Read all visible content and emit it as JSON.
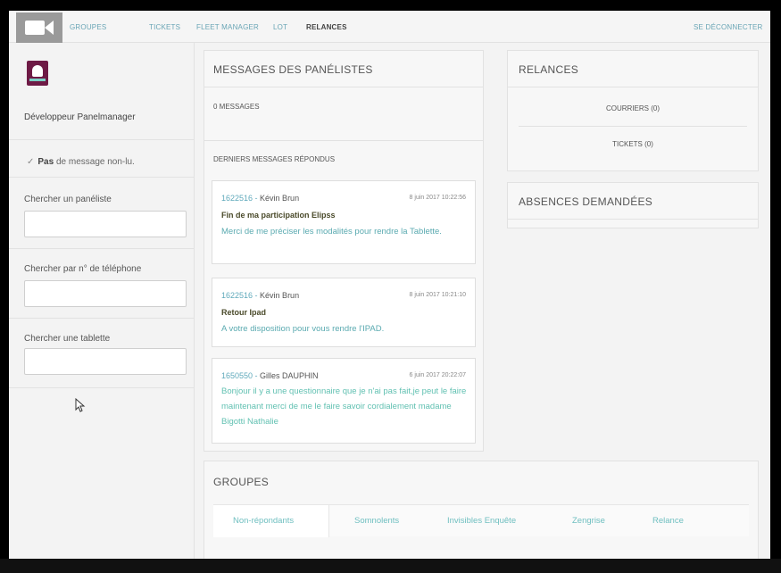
{
  "nav": {
    "items": [
      "GROUPES",
      "TICKETS",
      "FLEET MANAGER",
      "LOT",
      "RELANCES"
    ],
    "logout": "SE DÉCONNECTER"
  },
  "sidebar": {
    "user_name": "Développeur Panelmanager",
    "unread_bold": "Pas",
    "unread_rest": "de message non-lu.",
    "search_panelist_label": "Chercher un panéliste",
    "search_phone_label": "Chercher par n° de téléphone",
    "search_tablet_label": "Chercher une tablette",
    "search_panelist_value": "",
    "search_phone_value": "",
    "search_tablet_value": ""
  },
  "messages": {
    "title": "MESSAGES DES PANÉLISTES",
    "count": "0 MESSAGES",
    "replied_title": "DERNIERS MESSAGES RÉPONDUS",
    "items": [
      {
        "id": "1622516",
        "author": "Kévin Brun",
        "date": "8 juin 2017 10:22:56",
        "subject": "Fin de ma participation Elipss",
        "body": "Merci de me préciser les modalités pour rendre la Tablette."
      },
      {
        "id": "1622516",
        "author": "Kévin Brun",
        "date": "8 juin 2017 10:21:10",
        "subject": "Retour Ipad",
        "body": "A votre disposition pour vous rendre l'IPAD."
      },
      {
        "id": "1650550",
        "author": "Gilles DAUPHIN",
        "date": "6 juin 2017 20:22:07",
        "subject": "",
        "body": "Bonjour il y a une questionnaire que je n'ai pas fait,je peut le faire maintenant merci de me le faire savoir cordialement madame Bigotti Nathalie"
      }
    ]
  },
  "relances": {
    "title": "RELANCES",
    "courriers": "COURRIERS (0)",
    "tickets": "TICKETS (0)"
  },
  "absences": {
    "title": "ABSENCES DEMANDÉES"
  },
  "groupes": {
    "title": "GROUPES",
    "tabs": [
      "Non-répondants",
      "Somnolents",
      "Invisibles Enquête",
      "Zengrise",
      "Relance"
    ]
  },
  "colors": {
    "link": "#5fa9bb",
    "teal": "#62c1b2",
    "avatar": "#6e1a45"
  }
}
